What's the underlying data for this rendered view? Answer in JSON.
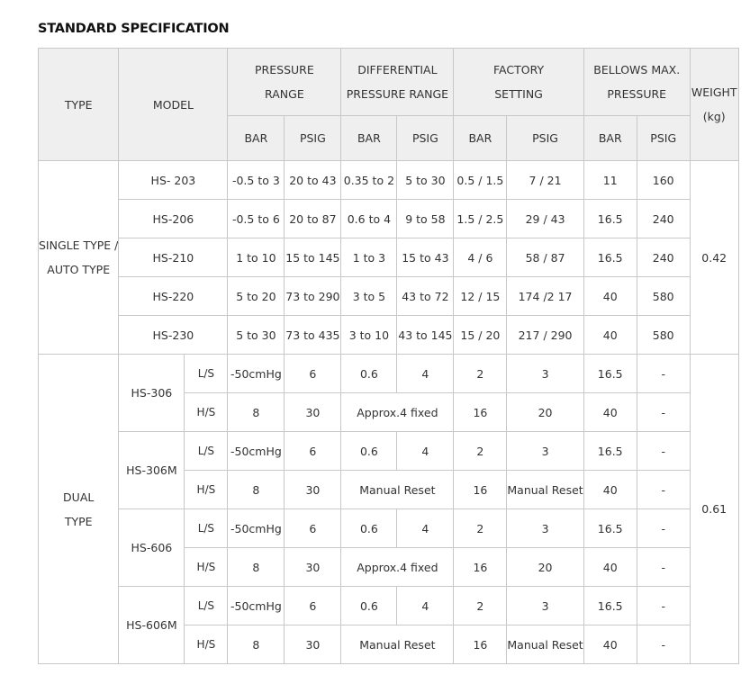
{
  "title": "STANDARD SPECIFICATION",
  "headers": {
    "type": "TYPE",
    "model": "MODEL",
    "pressure_range": [
      "PRESSURE",
      "RANGE"
    ],
    "differential": [
      "DIFFERENTIAL",
      "PRESSURE RANGE"
    ],
    "factory": [
      "FACTORY",
      "SETTING"
    ],
    "bellows": [
      "BELLOWS MAX.",
      "PRESSURE"
    ],
    "weight": [
      "WEIGHT",
      "(kg)"
    ],
    "units": [
      "BAR",
      "PSIG",
      "BAR",
      "PSIG",
      "BAR",
      "PSIG",
      "BAR",
      "PSIG"
    ]
  },
  "single": {
    "type": [
      "SINGLE TYPE /",
      "AUTO TYPE"
    ],
    "weight": "0.42",
    "rows": [
      {
        "model": "HS- 203",
        "cells": [
          "-0.5 to 3",
          "20 to 43",
          "0.35 to 2",
          "5 to 30",
          "0.5 / 1.5",
          "7 / 21",
          "11",
          "160"
        ]
      },
      {
        "model": "HS-206",
        "cells": [
          "-0.5 to 6",
          "20 to 87",
          "0.6 to 4",
          "9 to 58",
          "1.5 / 2.5",
          "29 / 43",
          "16.5",
          "240"
        ]
      },
      {
        "model": "HS-210",
        "cells": [
          "1 to 10",
          "15 to 145",
          "1 to 3",
          "15 to 43",
          "4 / 6",
          "58 / 87",
          "16.5",
          "240"
        ]
      },
      {
        "model": "HS-220",
        "cells": [
          "5 to 20",
          "73 to 290",
          "3 to 5",
          "43 to 72",
          "12 / 15",
          "174 /2 17",
          "40",
          "580"
        ]
      },
      {
        "model": "HS-230",
        "cells": [
          "5 to 30",
          "73 to 435",
          "3 to 10",
          "43 to 145",
          "15 / 20",
          "217 / 290",
          "40",
          "580"
        ]
      }
    ]
  },
  "dual": {
    "type": [
      "DUAL",
      "TYPE"
    ],
    "weight": "0.61",
    "groups": [
      {
        "model": "HS-306",
        "ls": {
          "label": "L/S",
          "cells": [
            "-50cmHg",
            "6",
            "0.6",
            "4",
            "2",
            "3",
            "16.5",
            "-"
          ]
        },
        "hs": {
          "label": "H/S",
          "cells": [
            "8",
            "30"
          ],
          "diff": "Approx.4 fixed",
          "cells2": [
            "16",
            "20",
            "40",
            "-"
          ]
        }
      },
      {
        "model": "HS-306M",
        "ls": {
          "label": "L/S",
          "cells": [
            "-50cmHg",
            "6",
            "0.6",
            "4",
            "2",
            "3",
            "16.5",
            "-"
          ]
        },
        "hs": {
          "label": "H/S",
          "cells": [
            "8",
            "30"
          ],
          "diff": "Manual Reset",
          "cells2": [
            "16",
            "Manual Reset",
            "40",
            "-"
          ]
        }
      },
      {
        "model": "HS-606",
        "ls": {
          "label": "L/S",
          "cells": [
            "-50cmHg",
            "6",
            "0.6",
            "4",
            "2",
            "3",
            "16.5",
            "-"
          ]
        },
        "hs": {
          "label": "H/S",
          "cells": [
            "8",
            "30"
          ],
          "diff": "Approx.4 fixed",
          "cells2": [
            "16",
            "20",
            "40",
            "-"
          ]
        }
      },
      {
        "model": "HS-606M",
        "ls": {
          "label": "L/S",
          "cells": [
            "-50cmHg",
            "6",
            "0.6",
            "4",
            "2",
            "3",
            "16.5",
            "-"
          ]
        },
        "hs": {
          "label": "H/S",
          "cells": [
            "8",
            "30"
          ],
          "diff": "Manual Reset",
          "cells2": [
            "16",
            "Manual Reset",
            "40",
            "-"
          ]
        }
      }
    ]
  }
}
